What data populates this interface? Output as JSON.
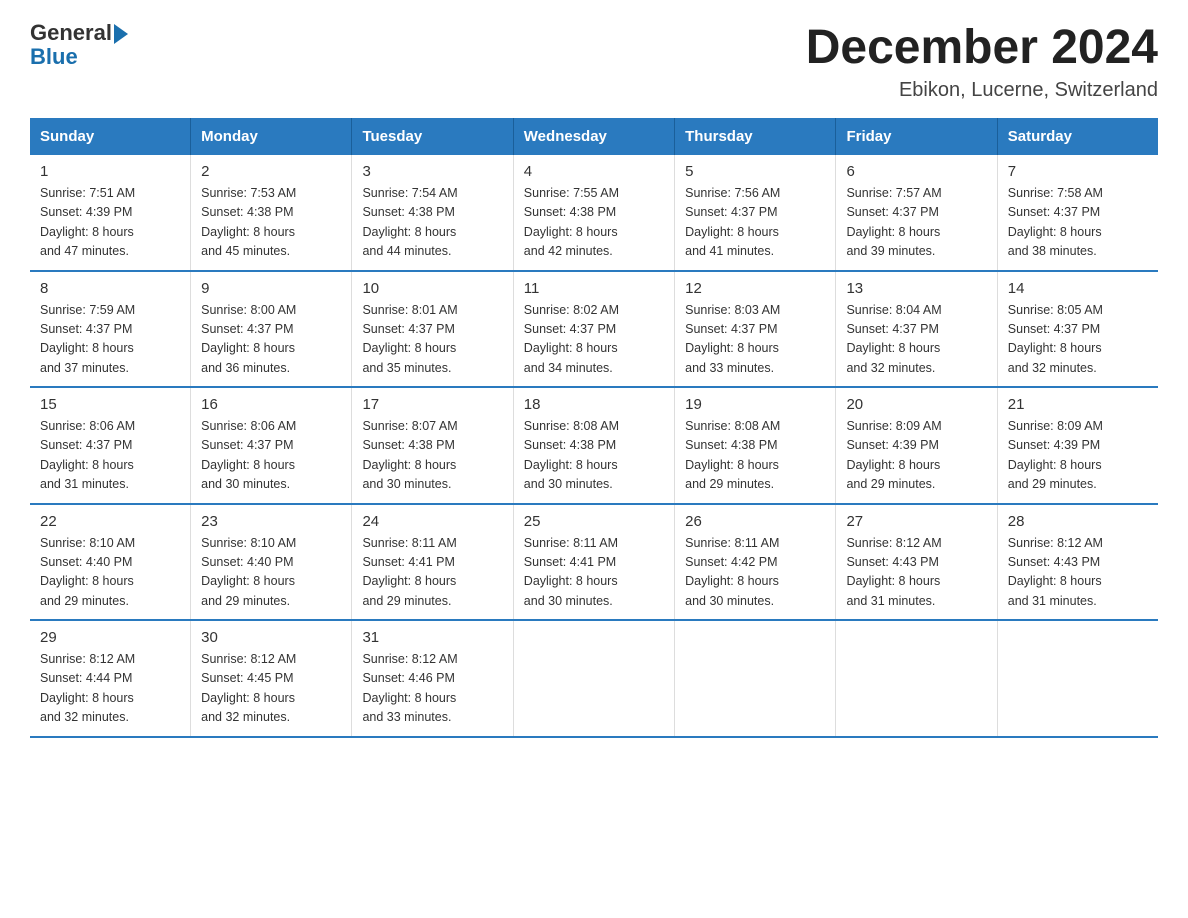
{
  "header": {
    "logo_general": "General",
    "logo_blue": "Blue",
    "title": "December 2024",
    "location": "Ebikon, Lucerne, Switzerland"
  },
  "weekdays": [
    "Sunday",
    "Monday",
    "Tuesday",
    "Wednesday",
    "Thursday",
    "Friday",
    "Saturday"
  ],
  "weeks": [
    [
      {
        "day": "1",
        "sunrise": "7:51 AM",
        "sunset": "4:39 PM",
        "daylight": "8 hours and 47 minutes."
      },
      {
        "day": "2",
        "sunrise": "7:53 AM",
        "sunset": "4:38 PM",
        "daylight": "8 hours and 45 minutes."
      },
      {
        "day": "3",
        "sunrise": "7:54 AM",
        "sunset": "4:38 PM",
        "daylight": "8 hours and 44 minutes."
      },
      {
        "day": "4",
        "sunrise": "7:55 AM",
        "sunset": "4:38 PM",
        "daylight": "8 hours and 42 minutes."
      },
      {
        "day": "5",
        "sunrise": "7:56 AM",
        "sunset": "4:37 PM",
        "daylight": "8 hours and 41 minutes."
      },
      {
        "day": "6",
        "sunrise": "7:57 AM",
        "sunset": "4:37 PM",
        "daylight": "8 hours and 39 minutes."
      },
      {
        "day": "7",
        "sunrise": "7:58 AM",
        "sunset": "4:37 PM",
        "daylight": "8 hours and 38 minutes."
      }
    ],
    [
      {
        "day": "8",
        "sunrise": "7:59 AM",
        "sunset": "4:37 PM",
        "daylight": "8 hours and 37 minutes."
      },
      {
        "day": "9",
        "sunrise": "8:00 AM",
        "sunset": "4:37 PM",
        "daylight": "8 hours and 36 minutes."
      },
      {
        "day": "10",
        "sunrise": "8:01 AM",
        "sunset": "4:37 PM",
        "daylight": "8 hours and 35 minutes."
      },
      {
        "day": "11",
        "sunrise": "8:02 AM",
        "sunset": "4:37 PM",
        "daylight": "8 hours and 34 minutes."
      },
      {
        "day": "12",
        "sunrise": "8:03 AM",
        "sunset": "4:37 PM",
        "daylight": "8 hours and 33 minutes."
      },
      {
        "day": "13",
        "sunrise": "8:04 AM",
        "sunset": "4:37 PM",
        "daylight": "8 hours and 32 minutes."
      },
      {
        "day": "14",
        "sunrise": "8:05 AM",
        "sunset": "4:37 PM",
        "daylight": "8 hours and 32 minutes."
      }
    ],
    [
      {
        "day": "15",
        "sunrise": "8:06 AM",
        "sunset": "4:37 PM",
        "daylight": "8 hours and 31 minutes."
      },
      {
        "day": "16",
        "sunrise": "8:06 AM",
        "sunset": "4:37 PM",
        "daylight": "8 hours and 30 minutes."
      },
      {
        "day": "17",
        "sunrise": "8:07 AM",
        "sunset": "4:38 PM",
        "daylight": "8 hours and 30 minutes."
      },
      {
        "day": "18",
        "sunrise": "8:08 AM",
        "sunset": "4:38 PM",
        "daylight": "8 hours and 30 minutes."
      },
      {
        "day": "19",
        "sunrise": "8:08 AM",
        "sunset": "4:38 PM",
        "daylight": "8 hours and 29 minutes."
      },
      {
        "day": "20",
        "sunrise": "8:09 AM",
        "sunset": "4:39 PM",
        "daylight": "8 hours and 29 minutes."
      },
      {
        "day": "21",
        "sunrise": "8:09 AM",
        "sunset": "4:39 PM",
        "daylight": "8 hours and 29 minutes."
      }
    ],
    [
      {
        "day": "22",
        "sunrise": "8:10 AM",
        "sunset": "4:40 PM",
        "daylight": "8 hours and 29 minutes."
      },
      {
        "day": "23",
        "sunrise": "8:10 AM",
        "sunset": "4:40 PM",
        "daylight": "8 hours and 29 minutes."
      },
      {
        "day": "24",
        "sunrise": "8:11 AM",
        "sunset": "4:41 PM",
        "daylight": "8 hours and 29 minutes."
      },
      {
        "day": "25",
        "sunrise": "8:11 AM",
        "sunset": "4:41 PM",
        "daylight": "8 hours and 30 minutes."
      },
      {
        "day": "26",
        "sunrise": "8:11 AM",
        "sunset": "4:42 PM",
        "daylight": "8 hours and 30 minutes."
      },
      {
        "day": "27",
        "sunrise": "8:12 AM",
        "sunset": "4:43 PM",
        "daylight": "8 hours and 31 minutes."
      },
      {
        "day": "28",
        "sunrise": "8:12 AM",
        "sunset": "4:43 PM",
        "daylight": "8 hours and 31 minutes."
      }
    ],
    [
      {
        "day": "29",
        "sunrise": "8:12 AM",
        "sunset": "4:44 PM",
        "daylight": "8 hours and 32 minutes."
      },
      {
        "day": "30",
        "sunrise": "8:12 AM",
        "sunset": "4:45 PM",
        "daylight": "8 hours and 32 minutes."
      },
      {
        "day": "31",
        "sunrise": "8:12 AM",
        "sunset": "4:46 PM",
        "daylight": "8 hours and 33 minutes."
      },
      null,
      null,
      null,
      null
    ]
  ],
  "labels": {
    "sunrise": "Sunrise:",
    "sunset": "Sunset:",
    "daylight": "Daylight:"
  }
}
